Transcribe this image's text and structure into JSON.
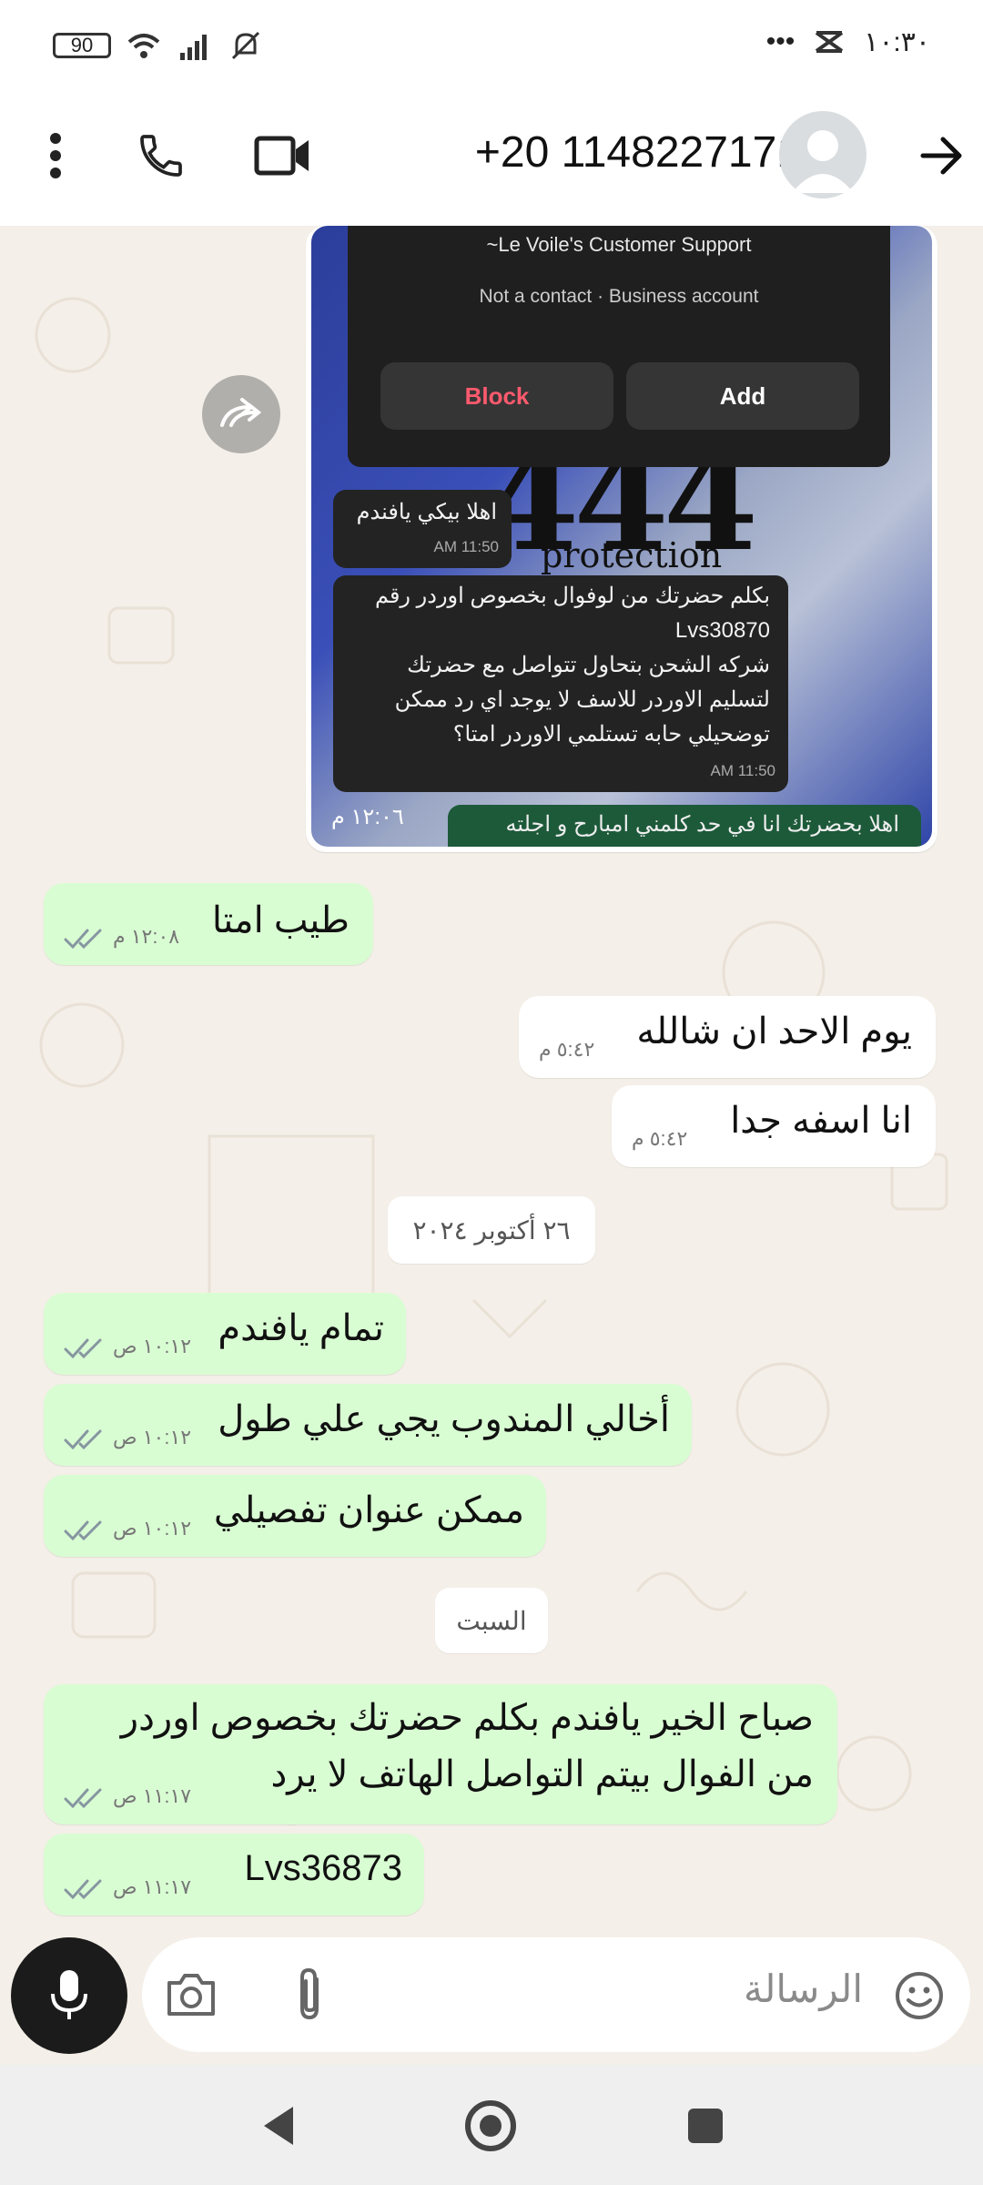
{
  "status_bar": {
    "battery": "90",
    "time": "١٠:٣٠",
    "more": "•••"
  },
  "header": {
    "contact": "+20 1148227171",
    "icons": [
      "more-vert-icon",
      "phone-icon",
      "video-icon",
      "back-arrow-icon"
    ]
  },
  "shared_image": {
    "popup_title": "~Le Voile's Customer Support",
    "popup_subtitle": "Not a contact · Business account",
    "block_label": "Block",
    "add_label": "Add",
    "big_text": "444",
    "sub_text": "protection",
    "msg1": {
      "text": "اهلا بيكي يافندم",
      "time": "11:50 AM"
    },
    "msg2": {
      "lines": [
        "بكلم حضرتك من لوفوال بخصوص اوردر رقم",
        "Lvs30870",
        "شركه الشحن بتحاول تتواصل مع حضرتك",
        "لتسليم الاوردر للاسف لا يوجد اي رد ممكن",
        "توضحيلي حابه تستلمي الاوردر امتا؟"
      ],
      "time": "11:50 AM"
    },
    "bottom_strip": "اهلا بحضرتك انا في حد كلمني امبارح و اجلته",
    "time": "١٢:٠٦ م"
  },
  "messages": [
    {
      "dir": "out",
      "text": "طيب امتا",
      "time": "١٢:٠٨ م"
    },
    {
      "dir": "in",
      "text": "يوم الاحد ان شالله",
      "time": "٥:٤٢ م"
    },
    {
      "dir": "in",
      "text": "انا اسفه جدا",
      "time": "٥:٤٢ م"
    },
    {
      "dir": "out",
      "text": "تمام يافندم",
      "time": "١٠:١٢ ص"
    },
    {
      "dir": "out",
      "text": "أخالي المندوب يجي علي طول",
      "time": "١٠:١٢ ص"
    },
    {
      "dir": "out",
      "text": "ممكن عنوان تفصيلي",
      "time": "١٠:١٢ ص"
    },
    {
      "dir": "out",
      "lines": [
        "صباح الخير يافندم بكلم حضرتك بخصوص اوردر",
        "من الفوال بيتم التواصل الهاتف لا يرد"
      ],
      "time": "١١:١٧ ص"
    },
    {
      "dir": "out",
      "text": "Lvs36873",
      "time": "١١:١٧ ص"
    }
  ],
  "dates": {
    "oct26": "٢٦ أكتوبر ٢٠٢٤",
    "saturday": "السبت"
  },
  "input": {
    "placeholder": "الرسالة"
  },
  "colors": {
    "outgoing": "#d9fdd3",
    "incoming": "#ffffff",
    "chat_bg": "#f4efe8",
    "ticks": "#8696a0"
  }
}
